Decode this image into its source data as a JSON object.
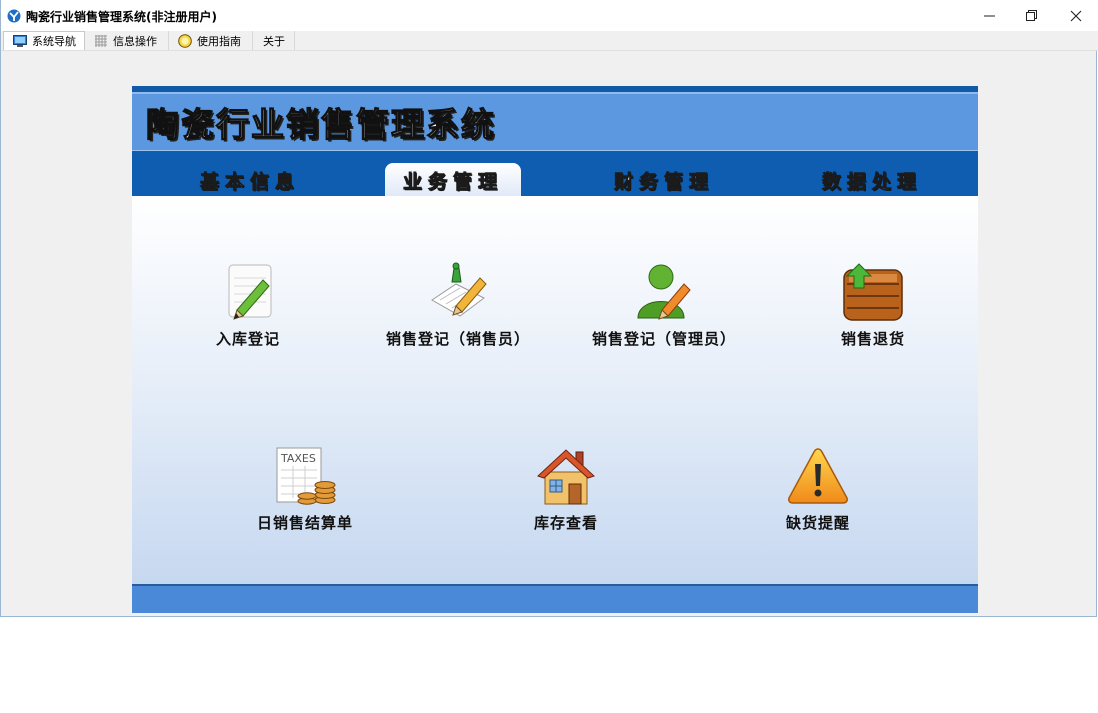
{
  "window": {
    "title": "陶瓷行业销售管理系统(非注册用户)",
    "controls": {
      "minimize": "—",
      "restore": "❐",
      "close": "✕"
    }
  },
  "menu": {
    "tabs": [
      {
        "label": "系统导航",
        "icon": "monitor-icon",
        "active": true
      },
      {
        "label": "信息操作",
        "icon": "grid-icon",
        "active": false
      },
      {
        "label": "使用指南",
        "icon": "help-globe-icon",
        "active": false
      },
      {
        "label": "关于",
        "icon": "",
        "active": false
      }
    ]
  },
  "app": {
    "heading": "陶瓷行业销售管理系统",
    "nav_tabs": [
      {
        "label": "基本信息",
        "active": false
      },
      {
        "label": "业务管理",
        "active": true
      },
      {
        "label": "财务管理",
        "active": false
      },
      {
        "label": "数据处理",
        "active": false
      }
    ],
    "features": [
      {
        "label": "入库登记",
        "icon": "notepad-pencil-icon"
      },
      {
        "label": "销售登记（销售员）",
        "icon": "checklist-pencil-icon"
      },
      {
        "label": "销售登记（管理员）",
        "icon": "user-pencil-icon"
      },
      {
        "label": "销售退货",
        "icon": "crate-arrow-icon"
      },
      {
        "label": "日销售结算单",
        "icon": "taxes-coins-icon"
      },
      {
        "label": "库存查看",
        "icon": "house-icon"
      },
      {
        "label": "缺货提醒",
        "icon": "warning-icon"
      }
    ]
  },
  "colors": {
    "banner": "#5b98e0",
    "tabbar": "#0f5db0",
    "footer": "#4a88d8"
  }
}
